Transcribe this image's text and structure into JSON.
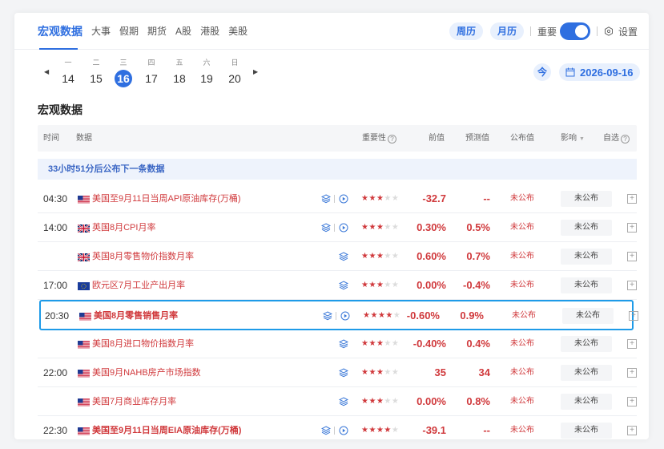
{
  "nav": {
    "tabs": [
      "宏观数据",
      "大事",
      "假期",
      "期货",
      "A股",
      "港股",
      "美股"
    ],
    "active_tab": 0,
    "week_cal": "周历",
    "month_cal": "月历",
    "important_label": "重要",
    "settings_label": "设置"
  },
  "dates": {
    "days": [
      {
        "weekday": "一",
        "num": "14"
      },
      {
        "weekday": "二",
        "num": "15"
      },
      {
        "weekday": "三",
        "num": "16"
      },
      {
        "weekday": "四",
        "num": "17"
      },
      {
        "weekday": "五",
        "num": "18"
      },
      {
        "weekday": "六",
        "num": "19"
      },
      {
        "weekday": "日",
        "num": "20"
      }
    ],
    "selected_index": 2,
    "today_label": "今",
    "current_date": "2026-09-16"
  },
  "section_title": "宏观数据",
  "table": {
    "headers": {
      "time": "时间",
      "data": "数据",
      "importance": "重要性",
      "prev": "前值",
      "forecast": "预测值",
      "published": "公布值",
      "impact": "影响",
      "watch": "自选"
    },
    "notice": "33小时51分后公布下一条数据",
    "rows": [
      {
        "time": "04:30",
        "flag": "us",
        "name": "美国至9月11日当周API原油库存(万桶)",
        "bold": false,
        "video": true,
        "stars": 3,
        "prev": "-32.7",
        "forecast": "--",
        "published": "未公布",
        "impact": "未公布"
      },
      {
        "time": "14:00",
        "flag": "uk",
        "name": "英国8月CPI月率",
        "bold": false,
        "video": true,
        "stars": 3,
        "prev": "0.30%",
        "forecast": "0.5%",
        "published": "未公布",
        "impact": "未公布"
      },
      {
        "time": "",
        "flag": "uk",
        "name": "英国8月零售物价指数月率",
        "bold": false,
        "video": false,
        "stars": 3,
        "prev": "0.60%",
        "forecast": "0.7%",
        "published": "未公布",
        "impact": "未公布"
      },
      {
        "time": "17:00",
        "flag": "eu",
        "name": "欧元区7月工业产出月率",
        "bold": false,
        "video": false,
        "stars": 3,
        "prev": "0.00%",
        "forecast": "-0.4%",
        "published": "未公布",
        "impact": "未公布"
      },
      {
        "time": "20:30",
        "flag": "us",
        "name": "美国8月零售销售月率",
        "bold": true,
        "video": true,
        "stars": 4,
        "prev": "-0.60%",
        "forecast": "0.9%",
        "published": "未公布",
        "impact": "未公布",
        "highlight": true
      },
      {
        "time": "",
        "flag": "us",
        "name": "美国8月进口物价指数月率",
        "bold": false,
        "video": false,
        "stars": 3,
        "prev": "-0.40%",
        "forecast": "0.4%",
        "published": "未公布",
        "impact": "未公布"
      },
      {
        "time": "22:00",
        "flag": "us",
        "name": "美国9月NAHB房产市场指数",
        "bold": false,
        "video": false,
        "stars": 3,
        "prev": "35",
        "forecast": "34",
        "published": "未公布",
        "impact": "未公布"
      },
      {
        "time": "",
        "flag": "us",
        "name": "美国7月商业库存月率",
        "bold": false,
        "video": false,
        "stars": 3,
        "prev": "0.00%",
        "forecast": "0.8%",
        "published": "未公布",
        "impact": "未公布"
      },
      {
        "time": "22:30",
        "flag": "us",
        "name": "美国至9月11日当周EIA原油库存(万桶)",
        "bold": true,
        "video": true,
        "stars": 4,
        "prev": "-39.1",
        "forecast": "--",
        "published": "未公布",
        "impact": "未公布"
      }
    ]
  },
  "colors": {
    "accent": "#2f6fe0",
    "red": "#d0393c",
    "highlight_border": "#1e9be8"
  }
}
